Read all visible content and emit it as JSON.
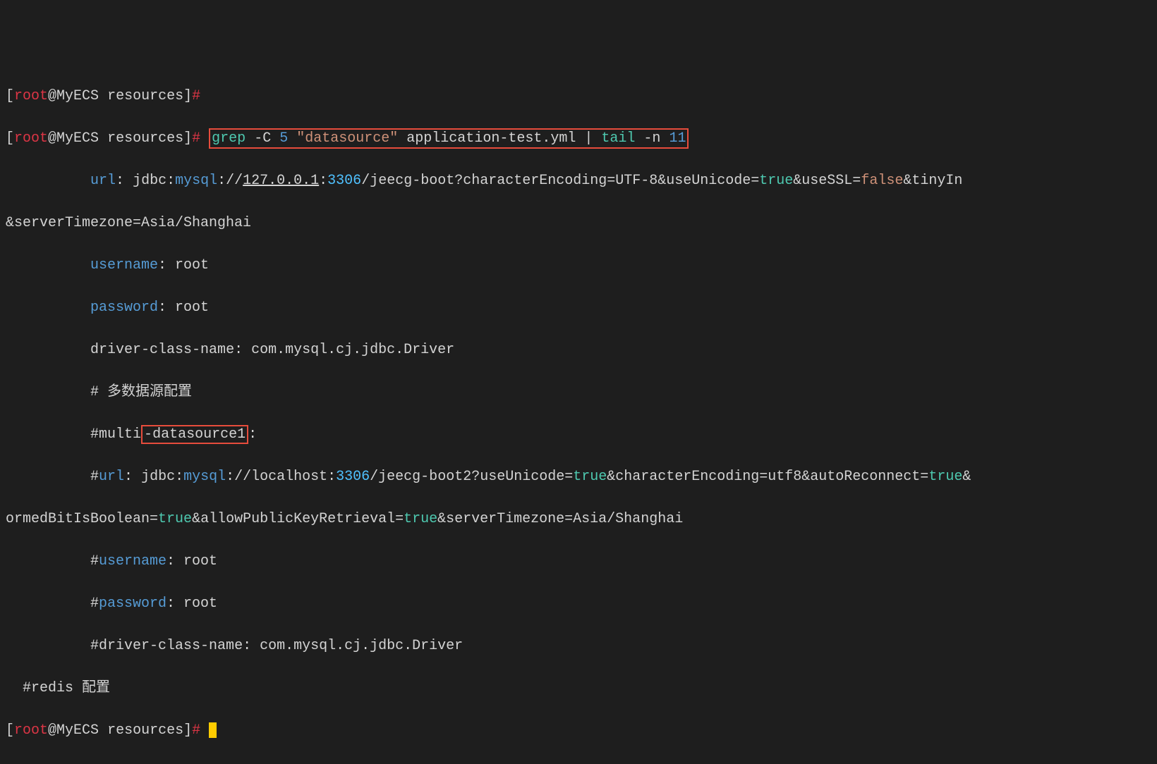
{
  "prompt": {
    "open_bracket": "[",
    "user": "root",
    "at": "@",
    "host": "MyECS",
    "path": "resources",
    "close_bracket": "]",
    "hash": "#"
  },
  "command": {
    "grep": "grep",
    "flag_c": "-C",
    "context_num": "5",
    "search_str": "\"datasource\"",
    "filename": "application-test.yml",
    "pipe": "|",
    "tail": "tail",
    "flag_n": "-n",
    "tail_num": "11"
  },
  "output": {
    "line1": {
      "indent": "          ",
      "url_key": "url",
      "colon": ":",
      "jdbc": " jdbc",
      "mysql": "mysql",
      "slashes": "://",
      "ip": "127.0.0.1",
      "port_colon": ":",
      "port": "3306",
      "path": "/jeecg-boot?characterEncoding=UTF-8&useUnicode=",
      "true1": "true",
      "amp_ssl": "&useSSL=",
      "false1": "false",
      "amp_tiny": "&tinyIn"
    },
    "line2": {
      "text": "&serverTimezone=Asia/Shanghai"
    },
    "line3": {
      "indent": "          ",
      "key": "username",
      "value": ": root"
    },
    "line4": {
      "indent": "          ",
      "key": "password",
      "value": ": root"
    },
    "line5": {
      "indent": "          ",
      "text": "driver-class-name: com.mysql.cj.jdbc.Driver"
    },
    "line6": {
      "indent": "          ",
      "text": "# 多数据源配置"
    },
    "line7": {
      "indent": "          ",
      "prefix": "#multi",
      "dash": "-",
      "highlighted": "datasource1",
      "suffix": ":"
    },
    "line8": {
      "indent": "          #",
      "url_key": "url",
      "colon": ":",
      "jdbc": " jdbc",
      "mysql": "mysql",
      "slashes": "://localhost",
      "port_colon": ":",
      "port": "3306",
      "path": "/jeecg-boot2?useUnicode=",
      "true1": "true",
      "enc": "&characterEncoding=utf8&autoReconnect=",
      "true2": "true",
      "amp": "&"
    },
    "line9": {
      "prefix": "ormedBitIsBoolean=",
      "true1": "true",
      "mid": "&allowPublicKeyRetrieval=",
      "true2": "true",
      "suffix": "&serverTimezone=Asia/Shanghai"
    },
    "line10": {
      "indent": "          #",
      "key": "username",
      "value": ": root"
    },
    "line11": {
      "indent": "          #",
      "key": "password",
      "value": ": root"
    },
    "line12": {
      "indent": "          #",
      "text": "driver-class-name: com.mysql.cj.jdbc.Driver"
    },
    "line13": {
      "text": "  #redis 配置"
    }
  }
}
